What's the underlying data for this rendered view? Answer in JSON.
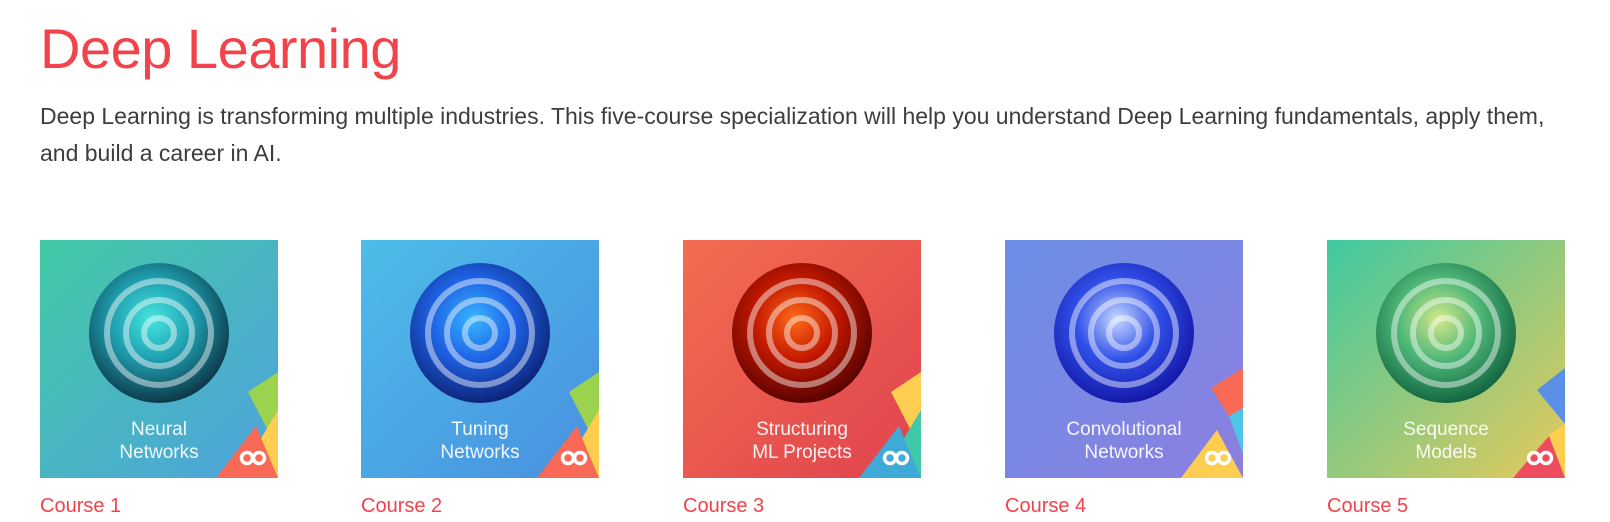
{
  "theme": {
    "accent": "#f2434b",
    "text": "#3d3d3d"
  },
  "header": {
    "title": "Deep Learning",
    "description": "Deep Learning is transforming multiple industries. This five-course specialization will help you understand Deep Learning fundamentals, apply them, and build a career in AI."
  },
  "courses": [
    {
      "line1": "Neural",
      "line2": "Networks",
      "link": "Course 1",
      "bg": [
        "#42c9a4",
        "#4fa2df"
      ],
      "circle": [
        "#0a2a3a",
        "#1f9fb0",
        "#46e6e0"
      ],
      "shapes": [
        "#9bd34f",
        "#ffcd4f",
        "#f86a55"
      ],
      "badge_icon": "infinity-logo-icon"
    },
    {
      "line1": "Tuning",
      "line2": "Networks",
      "link": "Course 2",
      "bg": [
        "#4cbde8",
        "#4a8fe0"
      ],
      "circle": [
        "#0a1b6a",
        "#1e63e6",
        "#38b6ff"
      ],
      "shapes": [
        "#9bd34f",
        "#ffcd4f",
        "#f86a55"
      ],
      "badge_icon": "infinity-logo-icon"
    },
    {
      "line1": "Structuring",
      "line2": "ML Projects",
      "link": "Course 3",
      "bg": [
        "#f36c4f",
        "#e0434f"
      ],
      "circle": [
        "#4a0000",
        "#c21800",
        "#ff6a1a"
      ],
      "shapes": [
        "#ffcd4f",
        "#3fc9a8",
        "#3fa9d8"
      ],
      "badge_icon": "infinity-logo-icon"
    },
    {
      "line1": "Convolutional",
      "line2": "Networks",
      "link": "Course 4",
      "bg": [
        "#6b8fe6",
        "#8c7fe0"
      ],
      "circle": [
        "#1010a0",
        "#3050e8",
        "#c8d8ff"
      ],
      "shapes": [
        "#f86a55",
        "#4fc4e8",
        "#ffcd4f"
      ],
      "badge_icon": "infinity-logo-icon"
    },
    {
      "line1": "Sequence",
      "line2": "Models",
      "link": "Course 5",
      "bg": [
        "#3ec9a0",
        "#e7c95a"
      ],
      "circle": [
        "#0a5a3a",
        "#4fb878",
        "#d4e88a"
      ],
      "shapes": [
        "#5a8fe6",
        "#ffcd4f",
        "#ef4b5f"
      ],
      "badge_icon": "infinity-logo-icon"
    }
  ]
}
